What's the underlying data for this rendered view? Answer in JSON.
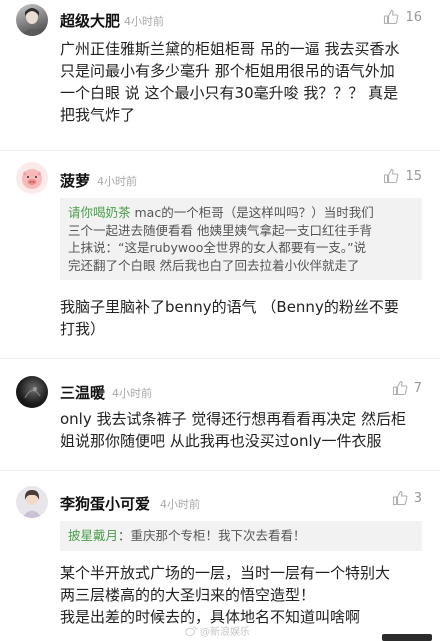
{
  "comments": [
    {
      "name": "超级大肥",
      "time": "4小时前",
      "likes": "16",
      "lines": [
        "广州正佳雅斯兰黛的柜姐柜哥 吊的一逼 我去买香水",
        "只是问最小有多少毫升  那个柜姐用很吊的语气外加",
        "一个白眼 说 这个最小只有30毫升唆 我？？？ 真是",
        "把我气炸了"
      ]
    },
    {
      "name": "菠萝",
      "time": "4小时前",
      "likes": "15",
      "quote_user": "请你喝奶茶",
      "quote_lines": [
        " mac的一个柜哥（是这样叫吗？）当时我们",
        "三个一起进去随便看看 他姨里姨气拿起一支口红往手背",
        "上抹说：“这是rubywoo全世界的女人都要有一支。”说",
        "完还翻了个白眼 然后我也白了回去拉着小伙伴就走了"
      ],
      "lines": [
        "我脑子里脑补了benny的语气    （Benny的粉丝不要",
        "打我）"
      ]
    },
    {
      "name": "三温暖",
      "time": "4小时前",
      "likes": "7",
      "lines": [
        "only 我去试条裤子 觉得还行想再看看再决定 然后柜",
        "姐说那你随便吧 从此我再也没买过only一件衣服"
      ]
    },
    {
      "name": "李狗蛋小可爱",
      "time": "4小时前",
      "likes": "3",
      "quote_user": "披星戴月",
      "quote_lines": [
        "：重庆那个专柜！我下次去看看！"
      ],
      "lines": [
        "某个半开放式广场的一层，当时一层有一个特别大",
        "两三层楼高的的大圣归来的悟空造型！",
        "我是出差的时候去的，具体地名不知道叫啥啊"
      ]
    }
  ],
  "watermark": "@新浪娱乐",
  "icons": {
    "like": "thumbs-up-icon"
  },
  "colors": {
    "quote_user": "#4a9e4a",
    "time": "#a8a8a8",
    "quote_bg": "#f2f2f2"
  }
}
